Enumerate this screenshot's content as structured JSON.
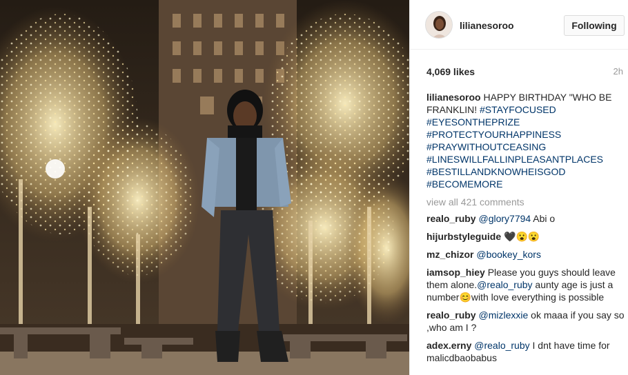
{
  "post": {
    "username": "lilianesoroo",
    "follow_label": "Following",
    "likes": "4,069 likes",
    "time": "2h",
    "caption": {
      "user": "lilianesoroo",
      "text": "HAPPY BIRTHDAY \"WHO BE FRANKLIN!",
      "tag0": "#STAYFOCUSED",
      "tags": [
        "#EYESONTHEPRIZE",
        "#PROTECTYOURHAPPINESS",
        "#PRAYWITHOUTCEASING",
        "#LINESWILLFALLINPLEASANTPLACES",
        "#BESTILLANDKNOWHEISGOD",
        "#BECOMEMORE"
      ]
    },
    "view_all": "view all 421 comments",
    "comments": [
      {
        "user": "realo_ruby",
        "mention": "@glory7794",
        "text": " Abi o"
      },
      {
        "user": "hijurbstyleguide",
        "text": "🖤😮😮"
      },
      {
        "user": "mz_chizor",
        "mention": "@bookey_kors",
        "text": ""
      },
      {
        "user": "iamsop_hiey",
        "text": "Please you guys should leave them alone.",
        "mention": "@realo_ruby",
        "text2": " aunty age is just a number😊with love everything is possible"
      },
      {
        "user": "realo_ruby",
        "mention": "@mizlexxie",
        "text": " ok maaa if you say so ,who am I ?"
      },
      {
        "user": "adex.erny",
        "mention": "@realo_ruby",
        "text": " I dnt have time for malicdbaobabus"
      }
    ]
  },
  "colors": {
    "link": "#003569",
    "muted": "#999999",
    "text": "#262626"
  },
  "icons": {
    "avatar": "profile-avatar"
  }
}
